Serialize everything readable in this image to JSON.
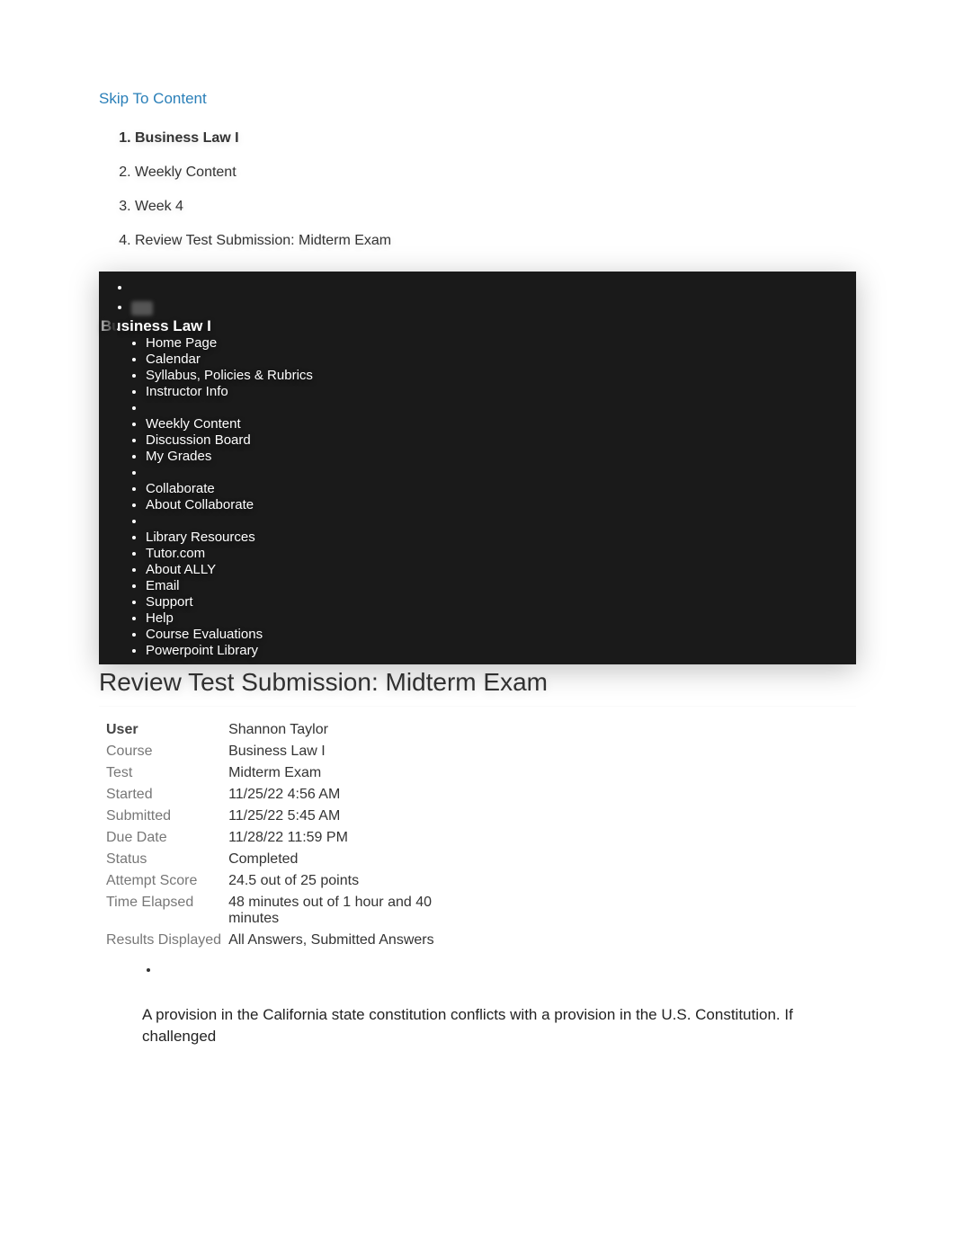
{
  "skip_link": "Skip To Content",
  "breadcrumb": [
    {
      "label": "Business Law I",
      "bold": true
    },
    {
      "label": "Weekly Content",
      "bold": false
    },
    {
      "label": "Week 4",
      "bold": false
    },
    {
      "label": "Review Test Submission: Midterm Exam",
      "bold": false
    }
  ],
  "sidebar": {
    "course_title": "Business Law I",
    "items": [
      {
        "label": "Home Page"
      },
      {
        "label": "Calendar"
      },
      {
        "label": "Syllabus, Policies & Rubrics"
      },
      {
        "label": "Instructor Info"
      },
      {
        "spacer": true
      },
      {
        "label": "Weekly Content"
      },
      {
        "label": "Discussion Board"
      },
      {
        "label": "My Grades"
      },
      {
        "spacer": true
      },
      {
        "label": "Collaborate"
      },
      {
        "label": "About Collaborate"
      },
      {
        "spacer": true
      },
      {
        "label": "Library Resources"
      },
      {
        "label": "Tutor.com"
      },
      {
        "label": "About ALLY"
      },
      {
        "label": "Email"
      },
      {
        "label": "Support"
      },
      {
        "label": "Help"
      },
      {
        "label": "Course Evaluations"
      },
      {
        "label": "Powerpoint Library"
      }
    ]
  },
  "page_title": "Review Test Submission: Midterm Exam",
  "details": {
    "rows": [
      {
        "label": "User",
        "value": "Shannon Taylor",
        "bold_label": true
      },
      {
        "label": "Course",
        "value": "Business Law I"
      },
      {
        "label": "Test",
        "value": "Midterm Exam"
      },
      {
        "label": "Started",
        "value": "11/25/22 4:56 AM"
      },
      {
        "label": "Submitted",
        "value": "11/25/22 5:45 AM"
      },
      {
        "label": "Due Date",
        "value": "11/28/22 11:59 PM"
      },
      {
        "label": "Status",
        "value": "Completed"
      },
      {
        "label": "Attempt Score",
        "value": "24.5 out of 25 points"
      },
      {
        "label": "Time Elapsed",
        "value": "48 minutes out of 1 hour and 40 minutes"
      },
      {
        "label": "Results Displayed",
        "value": "All Answers, Submitted Answers"
      }
    ]
  },
  "question": {
    "text": "A provision in the California state constitution conflicts with a provision in the U.S. Constitution. If challenged"
  }
}
